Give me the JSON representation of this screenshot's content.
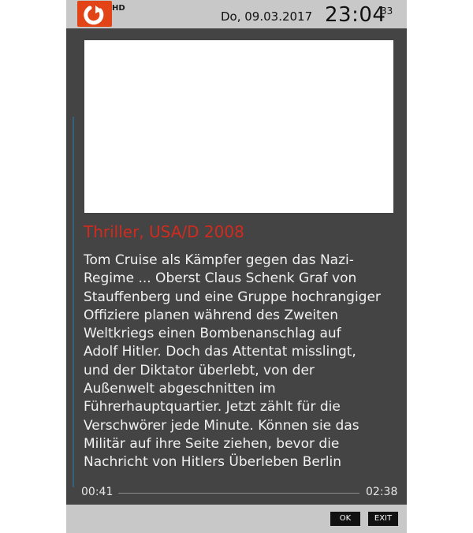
{
  "header": {
    "channel_logo_badge": "HD",
    "date": "Do, 09.03.2017",
    "time": "23:04",
    "seconds": "33"
  },
  "program": {
    "genre_line": "Thriller, USA/D 2008",
    "description_lines": [
      "Tom Cruise als Kämpfer gegen das Nazi-",
      "Regime ... Oberst Claus Schenk Graf von",
      "Stauffenberg und eine Gruppe hochrangiger",
      "Offiziere planen während des Zweiten",
      "Weltkriegs einen Bombenanschlag auf",
      "Adolf Hitler. Doch das Attentat misslingt,",
      "und der Diktator überlebt, von der",
      "Außenwelt abgeschnitten im",
      "Führerhauptquartier. Jetzt zählt für die",
      "Verschwörer jede Minute. Können sie das",
      "Militär auf ihre Seite ziehen, bevor die",
      "Nachricht von Hitlers Überleben Berlin"
    ]
  },
  "progress": {
    "start_time": "00:41",
    "end_time": "02:38"
  },
  "footer": {
    "ok_label": "OK",
    "exit_label": "EXIT"
  },
  "colors": {
    "panel": "#444444",
    "bars": "#c8c8c8",
    "genre": "#d42a1e",
    "logo": "#e24417"
  },
  "icons": {
    "channel_logo": "kabel-eins-logo-icon"
  }
}
